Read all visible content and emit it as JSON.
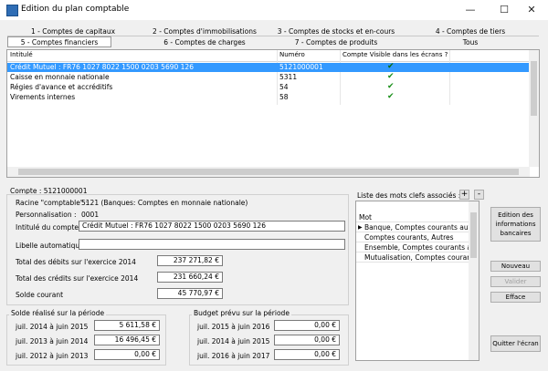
{
  "window": {
    "title": "Edition du plan comptable",
    "minimize": "—",
    "maximize": "☐",
    "close": "✕"
  },
  "tabs_row1": [
    "1 - Comptes de capitaux",
    "2 - Comptes d'immobilisations",
    "3 - Comptes de stocks et en-cours",
    "4 - Comptes de tiers"
  ],
  "tabs_row2": [
    "5 - Comptes financiers",
    "6 - Comptes de charges",
    "7 - Comptes de produits",
    "Tous"
  ],
  "grid": {
    "headers": [
      "Intitulé",
      "Numéro",
      "Compte Visible dans les écrans ?"
    ],
    "rows": [
      {
        "intitule": "Crédit Mutuel : FR76 1027 8022 1500 0203 5690 126",
        "numero": "5121000001",
        "visible": "✔"
      },
      {
        "intitule": "Caisse en monnaie nationale",
        "numero": "5311",
        "visible": "✔"
      },
      {
        "intitule": "Régies d'avance et accréditifs",
        "numero": "54",
        "visible": "✔"
      },
      {
        "intitule": "Virements internes",
        "numero": "58",
        "visible": "✔"
      }
    ]
  },
  "detail": {
    "compte_label": "Compte : 5121000001",
    "racine_label": "Racine \"comptable\" :",
    "racine_value": "5121 (Banques: Comptes en monnaie nationale)",
    "perso_label": "Personnalisation :",
    "perso_value": "0001",
    "intitule_label": "Intitulé du compte :",
    "intitule_value": "Crédit Mutuel : FR76 1027 8022 1500 0203 5690 126",
    "libelle_label": "Libelle automatique :",
    "libelle_value": "",
    "debits_label": "Total des débits sur l'exercice 2014",
    "debits_value": "237 271,82 €",
    "credits_label": "Total des crédits sur l'exercice 2014",
    "credits_value": "231 660,24 €",
    "solde_label": "Solde courant",
    "solde_value": "45 770,97 €"
  },
  "solde_periode": {
    "title": "Solde réalisé sur la période",
    "rows": [
      {
        "label": "juil. 2014 à juin 2015",
        "value": "5 611,58 €"
      },
      {
        "label": "juil. 2013 à juin 2014",
        "value": "16 496,45 €"
      },
      {
        "label": "juil. 2012 à juin 2013",
        "value": "0,00 €"
      }
    ]
  },
  "budget_periode": {
    "title": "Budget prévu sur la période",
    "rows": [
      {
        "label": "juil. 2015 à juin 2016",
        "value": "0,00 €"
      },
      {
        "label": "juil. 2014 à juin 2015",
        "value": "0,00 €"
      },
      {
        "label": "juil. 2016 à juin 2017",
        "value": "0,00 €"
      }
    ]
  },
  "keywords": {
    "title": "Liste des mots clefs associés :",
    "add": "+",
    "remove": "-",
    "header": "Mot",
    "items": [
      "Banque, Comptes courants autres",
      "Comptes courants, Autres",
      "Ensemble, Comptes courants autres",
      "Mutualisation, Comptes courants autres"
    ]
  },
  "buttons": {
    "edition": "Edition des informations bancaires",
    "nouveau": "Nouveau",
    "valider": "Valider",
    "efface": "Efface",
    "quitter": "Quitter l'écran"
  }
}
